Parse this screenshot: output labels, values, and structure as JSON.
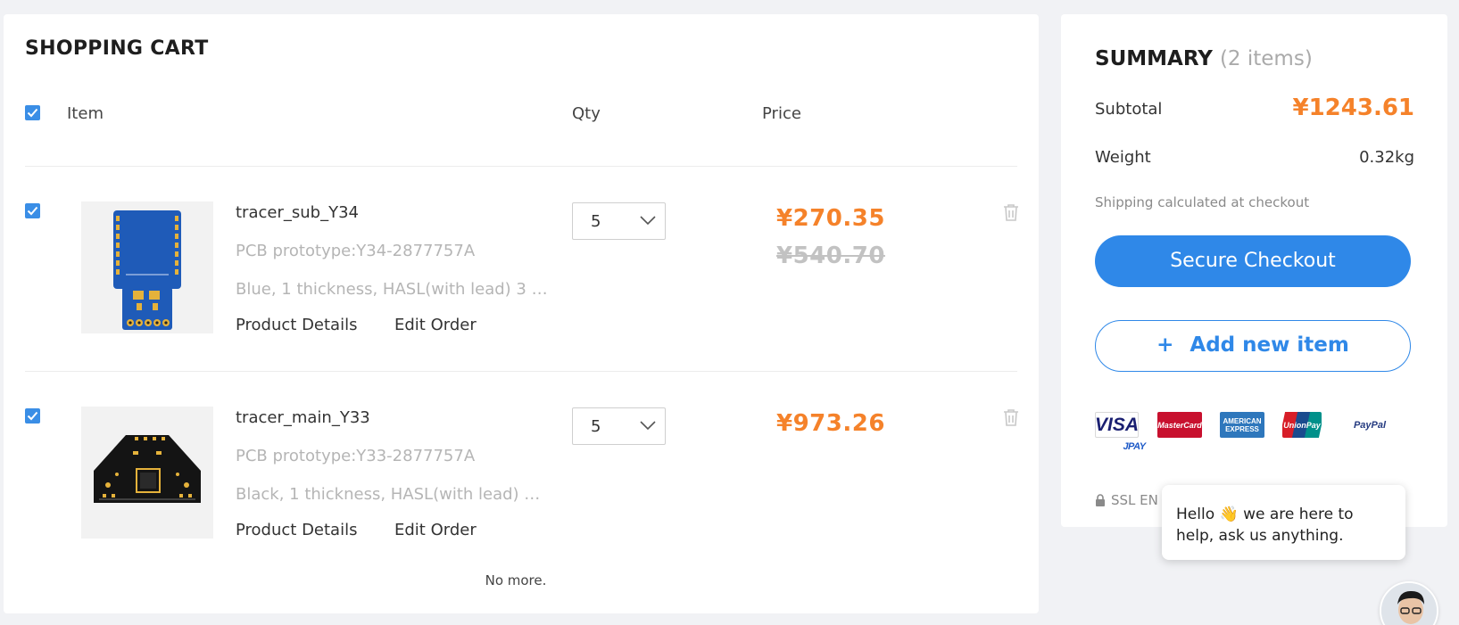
{
  "cart": {
    "title": "SHOPPING CART",
    "columns": {
      "item": "Item",
      "qty": "Qty",
      "price": "Price"
    },
    "items": [
      {
        "name": "tracer_sub_Y34",
        "type": "PCB prototype:Y34-2877757A",
        "spec": "Blue, 1 thickness, HASL(with lead) 3 d···",
        "details_label": "Product Details",
        "edit_label": "Edit Order",
        "qty": "5",
        "price": "¥270.35",
        "old_price": "¥540.70",
        "pcb_color": "#1f5bb8"
      },
      {
        "name": "tracer_main_Y33",
        "type": "PCB prototype:Y33-2877757A",
        "spec": "Black, 1 thickness, HASL(with lead) 3 ···",
        "details_label": "Product Details",
        "edit_label": "Edit Order",
        "qty": "5",
        "price": "¥973.26",
        "pcb_color": "#141414"
      }
    ],
    "footer": "No more."
  },
  "summary": {
    "title": "SUMMARY",
    "count": "(2 items)",
    "subtotal_label": "Subtotal",
    "subtotal": "¥1243.61",
    "weight_label": "Weight",
    "weight": "0.32kg",
    "shipping_note": "Shipping calculated at checkout",
    "checkout_label": "Secure Checkout",
    "add_label": "Add new item",
    "add_icon": "+",
    "payment_logos": {
      "visa": "VISA",
      "mastercard": "MasterCard",
      "amex_1": "AMERICAN",
      "amex_2": "EXPRESS",
      "unionpay": "UnionPay",
      "paypal": "PayPal",
      "jpay": "JPAY"
    },
    "ssl_text": "SSL EN"
  },
  "chat": {
    "message": "Hello 👋 we are here to help, ask us anything."
  },
  "colors": {
    "accent": "#2f88e8",
    "price": "#f5822a",
    "checkbox": "#3a8ee6"
  },
  "icons": [
    "check-icon",
    "chevron-down-icon",
    "trash-icon",
    "lock-icon",
    "plus-icon"
  ]
}
